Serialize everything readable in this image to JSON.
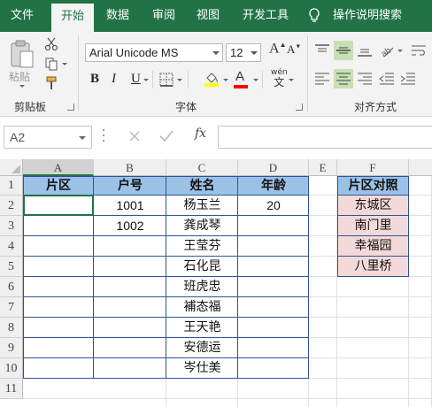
{
  "tabs": [
    {
      "label": "文件",
      "active": false
    },
    {
      "label": "开始",
      "active": true
    },
    {
      "label": "数据",
      "active": false
    },
    {
      "label": "审阅",
      "active": false
    },
    {
      "label": "视图",
      "active": false
    },
    {
      "label": "开发工具",
      "active": false
    }
  ],
  "tell_me": "操作说明搜索",
  "ribbon": {
    "paste_label": "粘贴",
    "clipboard_label": "剪贴板",
    "font_group_label": "字体",
    "align_group_label": "对齐方式",
    "font_name": "Arial Unicode MS",
    "font_size": "12",
    "bold_label": "B",
    "italic_label": "I",
    "underline_label": "U",
    "font_color_label": "A",
    "phonetic_label": "wén",
    "phonetic_sub": "文",
    "font_color": "#ff0000",
    "fill_color": "#ffff00"
  },
  "formula_bar": {
    "name_box": "A2",
    "fx_label": "fx",
    "formula": ""
  },
  "columns": [
    "A",
    "B",
    "C",
    "D",
    "E",
    "F"
  ],
  "rows": [
    "1",
    "2",
    "3",
    "4",
    "5",
    "6",
    "7",
    "8",
    "9",
    "10",
    "11"
  ],
  "table": {
    "headers": [
      "片区",
      "户号",
      "姓名",
      "年龄"
    ],
    "rows": [
      [
        "",
        "1001",
        "杨玉兰",
        "20"
      ],
      [
        "",
        "1002",
        "龚成琴",
        ""
      ],
      [
        "",
        "",
        "王莹芬",
        ""
      ],
      [
        "",
        "",
        "石化昆",
        ""
      ],
      [
        "",
        "",
        "班虎忠",
        ""
      ],
      [
        "",
        "",
        "補态福",
        ""
      ],
      [
        "",
        "",
        "王天艳",
        ""
      ],
      [
        "",
        "",
        "安德运",
        ""
      ],
      [
        "",
        "",
        "岑仕美",
        ""
      ]
    ],
    "header_color": "#9bc2e6"
  },
  "lookup": {
    "header": "片区对照",
    "items": [
      "东城区",
      "南门里",
      "幸福园",
      "八里桥"
    ],
    "item_color": "#f4d9d9"
  },
  "colors": {
    "accent": "#217346",
    "selected_col_header": "#d2d2d2"
  }
}
